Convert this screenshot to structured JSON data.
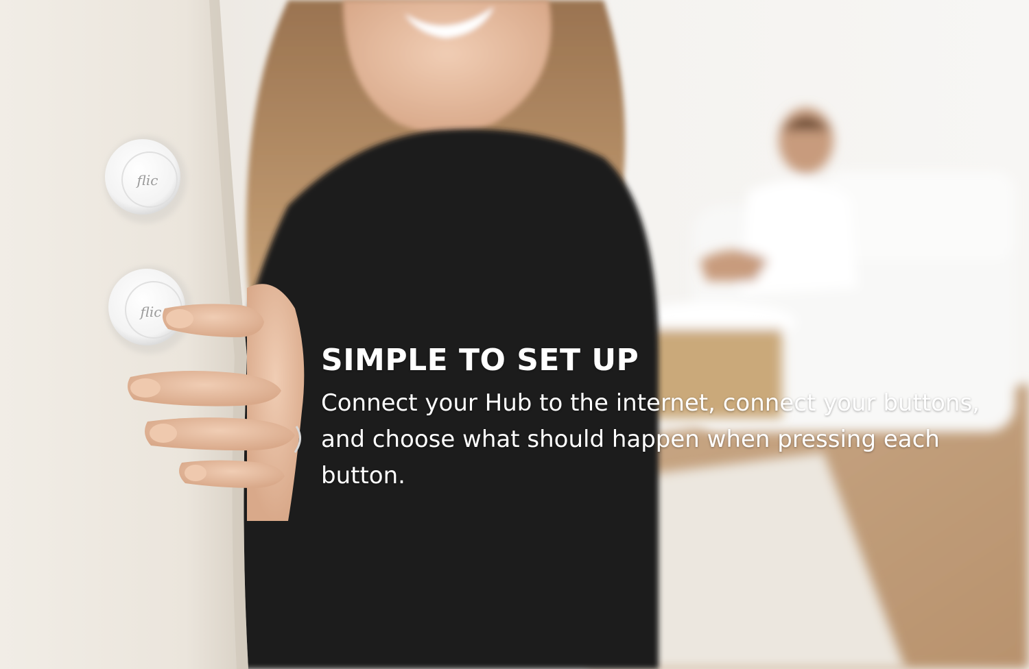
{
  "caption": {
    "title": "SIMPLE TO SET UP",
    "body": "Connect your Hub to the internet, connect your buttons, and choose what should happen when pressing each button."
  },
  "buttons": [
    {
      "logo_text": "flic"
    },
    {
      "logo_text": "flic"
    }
  ],
  "colors": {
    "caption_text": "#ffffff",
    "wall": "#ece7e0",
    "sweater": "#1c1a1a",
    "background_room": "#f3f1ee"
  }
}
